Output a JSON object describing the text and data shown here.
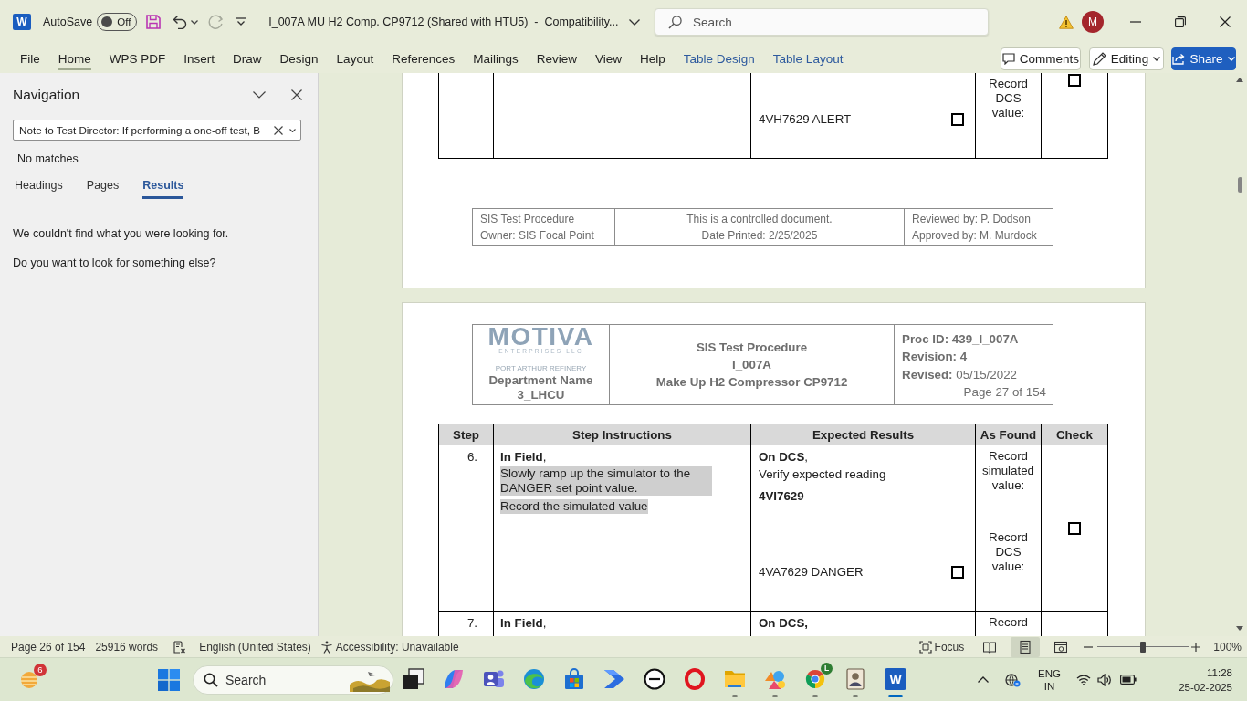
{
  "title_bar": {
    "app_letter": "W",
    "autosave": {
      "label": "AutoSave",
      "state": "Off",
      "on": false
    },
    "quick_access": [
      {
        "kind": "save",
        "disabled": false
      },
      {
        "kind": "undo",
        "disabled": false
      },
      {
        "kind": "redo",
        "disabled": true
      },
      {
        "kind": "customize",
        "disabled": false
      }
    ],
    "document_title": "I_007A MU H2 Comp. CP9712 (Shared with HTU5)  -  Compatibility...",
    "search": {
      "placeholder": "Search"
    },
    "avatar_letter": "M"
  },
  "ribbon": {
    "tabs": [
      {
        "label": "File",
        "kind": "standard",
        "selected": false
      },
      {
        "label": "Home",
        "kind": "standard",
        "selected": true
      },
      {
        "label": "WPS PDF",
        "kind": "standard",
        "selected": false
      },
      {
        "label": "Insert",
        "kind": "standard",
        "selected": false
      },
      {
        "label": "Draw",
        "kind": "standard",
        "selected": false
      },
      {
        "label": "Design",
        "kind": "standard",
        "selected": false
      },
      {
        "label": "Layout",
        "kind": "standard",
        "selected": false
      },
      {
        "label": "References",
        "kind": "standard",
        "selected": false
      },
      {
        "label": "Mailings",
        "kind": "standard",
        "selected": false
      },
      {
        "label": "Review",
        "kind": "standard",
        "selected": false
      },
      {
        "label": "View",
        "kind": "standard",
        "selected": false
      },
      {
        "label": "Help",
        "kind": "standard",
        "selected": false
      },
      {
        "label": "Table Design",
        "kind": "contextual",
        "selected": false
      },
      {
        "label": "Table Layout",
        "kind": "contextual",
        "selected": false
      }
    ],
    "actions": [
      {
        "kind": "comments",
        "label": "Comments"
      },
      {
        "kind": "editing",
        "label": "Editing"
      },
      {
        "kind": "share",
        "label": "Share"
      }
    ]
  },
  "navigation": {
    "title": "Navigation",
    "search": {
      "value": "Note to Test Director: If performing a one-off test, B"
    },
    "status": "No matches",
    "tabs": [
      {
        "label": "Headings",
        "selected": false
      },
      {
        "label": "Pages",
        "selected": false
      },
      {
        "label": "Results",
        "selected": true
      }
    ],
    "messages": [
      "We couldn't find what you were looking for.",
      "Do you want to look for something else?"
    ]
  },
  "document": {
    "previous_page": {
      "row": {
        "results": [
          {
            "text": "4VH7629 ALERT",
            "checked": false
          }
        ],
        "as_found": [
          "Record DCS value:"
        ],
        "check": {
          "checked": false
        }
      },
      "footer": [
        [
          "SIS Test Procedure",
          "Owner: SIS Focal Point"
        ],
        [
          "This is a controlled document.",
          "Date Printed: 2/25/2025"
        ],
        [
          "Reviewed by: P. Dodson",
          "Approved by: M. Murdock"
        ]
      ]
    },
    "current_page": {
      "header": {
        "logo": {
          "name": "MOTIVA",
          "tagline": "ENTERPRISES LLC",
          "site": "PORT ARTHUR REFINERY"
        },
        "department": [
          "Department Name",
          "3_LHCU"
        ],
        "title": [
          "SIS Test Procedure",
          "I_007A",
          "Make Up H2 Compressor CP9712"
        ],
        "meta": [
          {
            "text": "Proc ID: 439_I_007A",
            "bold": true
          },
          {
            "text": "Revision: 4",
            "bold": true
          },
          {
            "text": "**Revised:** 05/15/2022",
            "bold": false
          }
        ],
        "page": "Page 27 of 154"
      },
      "table": {
        "columns": [
          "Step",
          "Step Instructions",
          "Expected Results",
          "As Found",
          "Check"
        ],
        "rows": [
          {
            "step": "6.",
            "instructions": [
              {
                "text": "**In Field**,",
                "highlight": false
              },
              {
                "text": "Slowly ramp up the simulator to the DANGER set point value.",
                "highlight": true
              },
              {
                "text": "Record the simulated value",
                "highlight": true
              }
            ],
            "expected": [
              {
                "text": "**On DCS**,",
                "bold": false
              },
              {
                "text": "Verify expected reading",
                "bold": false
              },
              {
                "text": "4VI7629",
                "bold": true
              }
            ],
            "results": [
              {
                "text": "4VA7629 DANGER",
                "checked": false
              }
            ],
            "as_found": [
              "Record simulated value:",
              "Record DCS value:"
            ],
            "check": {
              "checked": false
            }
          },
          {
            "step": "7.",
            "instructions": [
              {
                "text": "**In Field**,",
                "highlight": false
              }
            ],
            "expected": [
              {
                "text": "On DCS,",
                "bold": true
              }
            ],
            "as_found": [
              "Record"
            ]
          }
        ]
      }
    }
  },
  "status_bar": {
    "page": "Page 26 of 154",
    "words": "25916 words",
    "language": "English (United States)",
    "accessibility": "Accessibility: Unavailable",
    "focus": "Focus",
    "views": [
      {
        "kind": "read",
        "selected": false
      },
      {
        "kind": "print",
        "selected": true
      },
      {
        "kind": "web",
        "selected": false
      }
    ],
    "zoom": {
      "level": 0.5,
      "reading": "100%"
    }
  },
  "taskbar": {
    "weather_badge": "6",
    "search": {
      "placeholder": "Search"
    },
    "apps": [
      {
        "kind": "window_stack",
        "running": false,
        "active": false
      },
      {
        "kind": "swirl",
        "running": false,
        "active": false
      },
      {
        "kind": "people",
        "running": false,
        "active": false
      },
      {
        "kind": "wave",
        "running": false,
        "active": false
      },
      {
        "kind": "bag",
        "running": false,
        "active": false
      },
      {
        "kind": "chevrons",
        "running": false,
        "active": false
      },
      {
        "kind": "ring_logo",
        "running": false,
        "active": false
      },
      {
        "kind": "ring",
        "running": false,
        "active": false
      },
      {
        "kind": "folder",
        "running": true,
        "active": false
      },
      {
        "kind": "shapes",
        "running": true,
        "active": false
      },
      {
        "kind": "color_wheel",
        "running": true,
        "active": false,
        "badge": "L"
      },
      {
        "kind": "portrait",
        "running": true,
        "active": false
      },
      {
        "kind": "letter_tile",
        "running": true,
        "active": true,
        "letter": "W"
      }
    ],
    "tray": {
      "language": "ENG",
      "region": "IN",
      "time": "11:28",
      "date": "25-02-2025"
    }
  }
}
